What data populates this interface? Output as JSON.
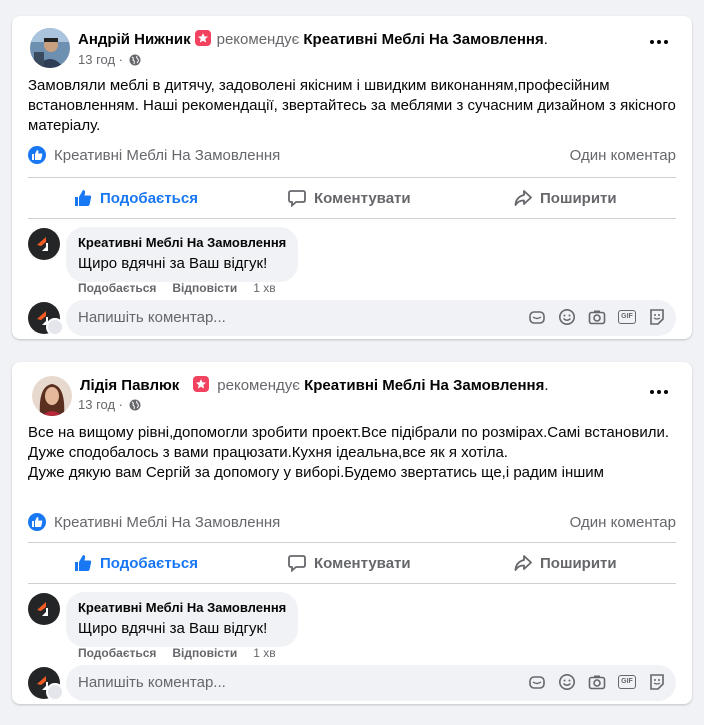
{
  "posts": [
    {
      "author": "Андрій Нижник",
      "verb": "рекомендує",
      "page": "Креативні Меблі На Замовлення",
      "period": ".",
      "time": "13 год",
      "dot": " · ",
      "text": [
        "Замовляли меблі в дитячу, задоволені якісним і швидким виконанням,професійним встановленням. Наші рекомендації, звертайтесь за меблями з сучасним дизайном з якісного матеріалу."
      ],
      "likes_name": "Креативні Меблі На Замовлення",
      "comments_count": "Один коментар",
      "actions": {
        "like": "Подобається",
        "comment": "Коментувати",
        "share": "Поширити"
      },
      "reply": {
        "name": "Креативні Меблі На Замовлення",
        "text": "Щиро вдячні за Ваш відгук!",
        "like": "Подобається",
        "reply": "Відповісти",
        "time": "1 хв"
      },
      "write_placeholder": "Напишіть коментар..."
    },
    {
      "author": "Лідія Павлюк",
      "verb": "рекомендує",
      "page": "Креативні Меблі На Замовлення",
      "period": ".",
      "time": "13 год",
      "dot": " · ",
      "text": [
        "Все на вищому рівні,допомогли зробити проект.Все підібрали по розмірах.Самі встановили.",
        "Дуже сподобалось з вами працюзати.Кухня ідеальна,все як я хотіла.",
        "Дуже дякую вам Сергій за допомогу у виборі.Будемо звертатись ще,і радим іншим"
      ],
      "likes_name": "Креативні Меблі На Замовлення",
      "comments_count": "Один коментар",
      "actions": {
        "like": "Подобається",
        "comment": "Коментувати",
        "share": "Поширити"
      },
      "reply": {
        "name": "Креативні Меблі На Замовлення",
        "text": "Щиро вдячні за Ваш відгук!",
        "like": "Подобається",
        "reply": "Відповісти",
        "time": "1 хв"
      },
      "write_placeholder": "Напишіть коментар..."
    }
  ],
  "icons": {
    "recommend": "recommend-star-icon",
    "audience": "globe-icon",
    "more": "more-options-icon",
    "like": "thumbs-up-icon",
    "comment": "comment-icon",
    "share": "share-arrow-icon",
    "brand": "brand-logo-icon",
    "input": [
      "sticker-icon",
      "emoji-icon",
      "camera-icon",
      "gif-icon",
      "avatar-sticker-icon"
    ]
  },
  "colors": {
    "accent": "#1877f2",
    "recommend": "#f3425f",
    "brand_orange": "#f25c24",
    "muted": "#65676b"
  }
}
